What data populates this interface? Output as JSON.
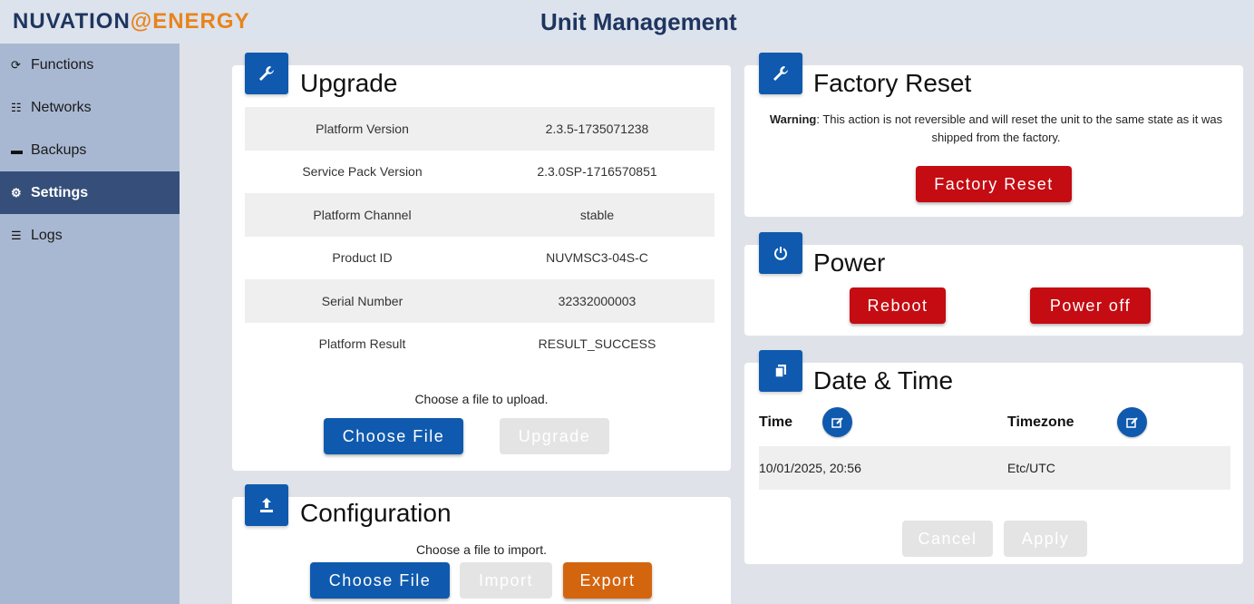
{
  "brand": {
    "part1": "NUVATION",
    "part2": "ENERGY",
    "symbol": "@"
  },
  "page_title": "Unit Management",
  "sidebar": {
    "items": [
      {
        "label": "Functions",
        "icon": "refresh-icon",
        "glyph": "⟳",
        "active": false
      },
      {
        "label": "Networks",
        "icon": "network-icon",
        "glyph": "☷",
        "active": false
      },
      {
        "label": "Backups",
        "icon": "drive-icon",
        "glyph": "▬",
        "active": false
      },
      {
        "label": "Settings",
        "icon": "gear-icon",
        "glyph": "⚙",
        "active": true
      },
      {
        "label": "Logs",
        "icon": "list-icon",
        "glyph": "☰",
        "active": false
      }
    ]
  },
  "upgrade": {
    "title": "Upgrade",
    "icon": "wrench-icon",
    "rows": [
      {
        "key": "Platform Version",
        "value": "2.3.5-1735071238"
      },
      {
        "key": "Service Pack Version",
        "value": "2.3.0SP-1716570851"
      },
      {
        "key": "Platform Channel",
        "value": "stable"
      },
      {
        "key": "Product ID",
        "value": "NUVMSC3-04S-C"
      },
      {
        "key": "Serial Number",
        "value": "32332000003"
      },
      {
        "key": "Platform Result",
        "value": "RESULT_SUCCESS"
      }
    ],
    "hint": "Choose a file to upload.",
    "choose_label": "Choose File",
    "upgrade_label": "Upgrade"
  },
  "configuration": {
    "title": "Configuration",
    "icon": "upload-icon",
    "hint": "Choose a file to import.",
    "choose_label": "Choose File",
    "import_label": "Import",
    "export_label": "Export"
  },
  "factory_reset": {
    "title": "Factory Reset",
    "icon": "wrench-icon",
    "warning_bold": "Warning",
    "warning_text": ": This action is not reversible and will reset the unit to the same state as it was shipped from the factory.",
    "button_label": "Factory Reset"
  },
  "power": {
    "title": "Power",
    "icon": "power-icon",
    "reboot_label": "Reboot",
    "poweroff_label": "Power off"
  },
  "datetime": {
    "title": "Date & Time",
    "icon": "copy-icon",
    "time_label": "Time",
    "timezone_label": "Timezone",
    "time_value": "10/01/2025, 20:56",
    "timezone_value": "Etc/UTC",
    "cancel_label": "Cancel",
    "apply_label": "Apply"
  },
  "colors": {
    "accent_blue": "#0f5aae",
    "danger_red": "#c40c12",
    "export_orange": "#d4650f",
    "sidebar_bg": "#a9b8d2",
    "sidebar_active": "#354f7a"
  }
}
